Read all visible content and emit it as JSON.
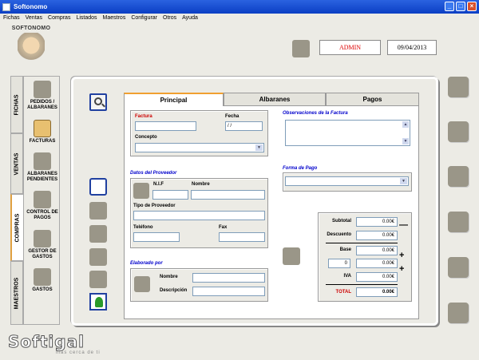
{
  "window": {
    "title": "Softonomo",
    "controls": [
      "_",
      "□",
      "×"
    ]
  },
  "menu": [
    "Fichas",
    "Ventas",
    "Compras",
    "Listados",
    "Maestros",
    "Configurar",
    "Otros",
    "Ayuda"
  ],
  "logo": {
    "brand": "SOFTONOMO"
  },
  "header": {
    "user": "ADMIN",
    "date": "09/04/2013"
  },
  "side_tabs": [
    "FICHAS",
    "VENTAS",
    "COMPRAS",
    "MAESTROS"
  ],
  "side_items": [
    "PEDIDOS / ALBARANES",
    "FACTURAS",
    "ALBARANES PENDIENTES",
    "CONTROL DE PAGOS",
    "GESTOR DE GASTOS",
    "GASTOS"
  ],
  "tabs": [
    "Principal",
    "Albaranes",
    "Pagos"
  ],
  "factura": {
    "factura_label": "Factura",
    "fecha_label": "Fecha",
    "fecha_value": "/ /",
    "concepto_label": "Concepto"
  },
  "observaciones": {
    "label": "Observaciones de la Factura"
  },
  "proveedor": {
    "title": "Datos del Proveedor",
    "nif_label": "N.I.F",
    "nombre_label": "Nombre",
    "tipo_label": "Tipo de Proveedor",
    "telefono_label": "Teléfono",
    "fax_label": "Fax"
  },
  "forma_pago": {
    "label": "Forma de Pago"
  },
  "totales": {
    "subtotal_label": "Subtotal",
    "subtotal": "0.00€",
    "descuento_label": "Descuento",
    "descuento": "0.00€",
    "base_label": "Base",
    "base": "0.00€",
    "pct": "0",
    "pct_value": "0.00€",
    "iva_label": "IVA",
    "iva": "0.00€",
    "total_label": "TOTAL",
    "total": "0.00€",
    "minus": "—",
    "plus": "+"
  },
  "elaborado": {
    "title": "Elaborado por",
    "nombre_label": "Nombre",
    "descripcion_label": "Descripción"
  },
  "footer": {
    "brand": "Softigal",
    "tagline": "más cerca de ti"
  }
}
